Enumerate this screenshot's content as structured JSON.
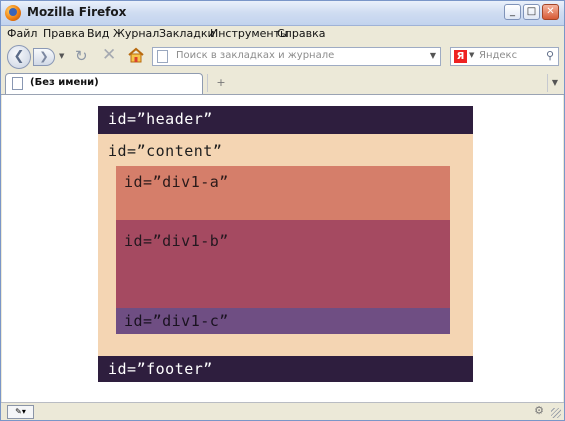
{
  "window": {
    "title": "Mozilla Firefox"
  },
  "menu": {
    "items": [
      "Файл",
      "Правка",
      "Вид",
      "Журнал",
      "Закладки",
      "Инструменты",
      "Справка"
    ]
  },
  "toolbar": {
    "url_placeholder": "Поиск в закладках и журнале",
    "search_placeholder": "Яндекс",
    "search_engine_badge": "Я"
  },
  "tabs": [
    {
      "label": "(Без имени)",
      "active": true
    }
  ],
  "page": {
    "header": "id=”header”",
    "content": "id=”content”",
    "div_a": "id=”div1-a”",
    "div_b": "id=”div1-b”",
    "div_c": "id=”div1-c”",
    "footer": "id=”footer”"
  },
  "colors": {
    "header_footer": "#2e1e3e",
    "content": "#f4d5b3",
    "div_a": "#d57e6a",
    "div_b": "#a54a61",
    "div_c": "#6f4e83"
  },
  "icons": [
    "firefox-logo",
    "back-arrow",
    "forward-arrow",
    "reload",
    "stop",
    "home",
    "page",
    "magnifier",
    "new-tab",
    "tab-list",
    "window-minimize",
    "window-maximize",
    "window-close",
    "resize-grip"
  ]
}
